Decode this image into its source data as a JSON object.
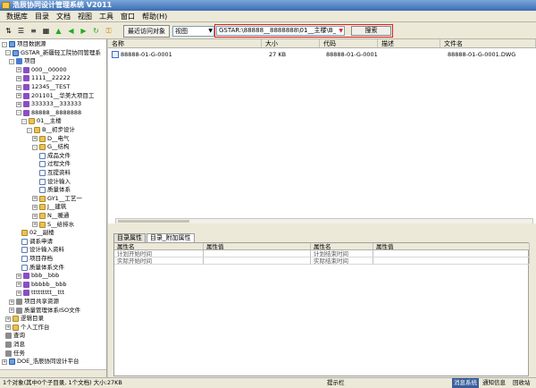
{
  "window": {
    "title": "浩辰协同设计管理系统 V2011"
  },
  "menu": [
    "数据库",
    "目录",
    "文档",
    "视图",
    "工具",
    "窗口",
    "帮助(H)"
  ],
  "toolbar": {
    "recent_label": "最近访问对象",
    "view_value": "视图",
    "path_value": "GSTAR:\\88888__8888888\\01__主楼\\B_",
    "search_label": "搜索"
  },
  "tree": [
    {
      "label": "项目数据源",
      "icon": "db-icon",
      "exp": "-"
    },
    {
      "label": "GSTAR_新疆轻工院协同管理系",
      "icon": "db-icon",
      "exp": "-"
    },
    {
      "label": "项目",
      "icon": "blue-icon",
      "exp": "-"
    },
    {
      "label": "000__00000",
      "icon": "purple-icon",
      "exp": "+"
    },
    {
      "label": "1111__22222",
      "icon": "purple-icon",
      "exp": "+"
    },
    {
      "label": "12345__TEST",
      "icon": "purple-icon",
      "exp": "+"
    },
    {
      "label": "201101__华美大项目工",
      "icon": "purple-icon",
      "exp": "+"
    },
    {
      "label": "333333__333333",
      "icon": "purple-icon",
      "exp": "+"
    },
    {
      "label": "88888__8888888",
      "icon": "purple-icon",
      "exp": "-"
    },
    {
      "label": "01__主楼",
      "icon": "folder-icon",
      "exp": "-"
    },
    {
      "label": "B__初步设计",
      "icon": "folder-icon",
      "exp": "-"
    },
    {
      "label": "D__电气",
      "icon": "folder-icon",
      "exp": "+"
    },
    {
      "label": "G__结构",
      "icon": "folder-icon",
      "exp": "-"
    },
    {
      "label": "成品文件",
      "icon": "doc-icon",
      "exp": ""
    },
    {
      "label": "过程文件",
      "icon": "doc-icon",
      "exp": ""
    },
    {
      "label": "互提资料",
      "icon": "doc-icon",
      "exp": ""
    },
    {
      "label": "设计输入",
      "icon": "doc-icon",
      "exp": ""
    },
    {
      "label": "质量体系",
      "icon": "doc-icon",
      "exp": ""
    },
    {
      "label": "GY1__工艺一",
      "icon": "folder-icon",
      "exp": "+"
    },
    {
      "label": "J__建筑",
      "icon": "folder-icon",
      "exp": "+"
    },
    {
      "label": "N__暖通",
      "icon": "folder-icon",
      "exp": "+"
    },
    {
      "label": "S__给排水",
      "icon": "folder-icon",
      "exp": "+"
    },
    {
      "label": "02__副楼",
      "icon": "folder-icon",
      "exp": ""
    },
    {
      "label": "调系申请",
      "icon": "doc-icon",
      "exp": ""
    },
    {
      "label": "设计输入资料",
      "icon": "doc-icon",
      "exp": ""
    },
    {
      "label": "项目存档",
      "icon": "doc-icon",
      "exp": ""
    },
    {
      "label": "质量体系文件",
      "icon": "doc-icon",
      "exp": ""
    },
    {
      "label": "bbb__bbb",
      "icon": "purple-icon",
      "exp": "+"
    },
    {
      "label": "bbbbb__bbb",
      "icon": "purple-icon",
      "exp": "+"
    },
    {
      "label": "ttttttttt__ttt",
      "icon": "purple-icon",
      "exp": "+"
    },
    {
      "label": "项目共享资源",
      "icon": "gray-icon",
      "exp": "+"
    },
    {
      "label": "质量管理体系ISO文件",
      "icon": "gray-icon",
      "exp": "+"
    },
    {
      "label": "逻辑目录",
      "icon": "folder-icon",
      "exp": "+"
    },
    {
      "label": "个人工作台",
      "icon": "folder-icon",
      "exp": "+"
    },
    {
      "label": "查询",
      "icon": "gray-icon",
      "exp": ""
    },
    {
      "label": "消息",
      "icon": "gray-icon",
      "exp": ""
    },
    {
      "label": "任务",
      "icon": "gray-icon",
      "exp": ""
    },
    {
      "label": "DOE_浩辰协同设计平台",
      "icon": "db-icon",
      "exp": "+"
    }
  ],
  "files": {
    "columns": [
      "名称",
      "大小",
      "代码",
      "描述",
      "文件名"
    ],
    "rows": [
      {
        "name": "88888-01-G-0001",
        "size": "27 KB",
        "code": "88888-01-G-0001",
        "desc": "",
        "filename": "88888-01-G-0001.DWG"
      }
    ]
  },
  "props": {
    "tabs": [
      "目录属性",
      "目录_附加属性"
    ],
    "active_tab": 1,
    "headers": [
      "属性名",
      "属性值",
      "属性名",
      "属性值"
    ],
    "rows": [
      [
        "计划开始时间",
        "",
        "计划结束时间",
        ""
      ],
      [
        "实际开始时间",
        "",
        "实际结束时间",
        ""
      ]
    ]
  },
  "status": {
    "left": "1个对象(其中0个子目录, 1个文档) 大小:27KB",
    "center": "提示栏",
    "badge": "消息系统",
    "notify": "通知信息",
    "recycle": "回收站"
  },
  "colors": {
    "title_bg": "#3b6db4",
    "highlight": "#dd2222",
    "status_badge": "#3a5f9a"
  }
}
